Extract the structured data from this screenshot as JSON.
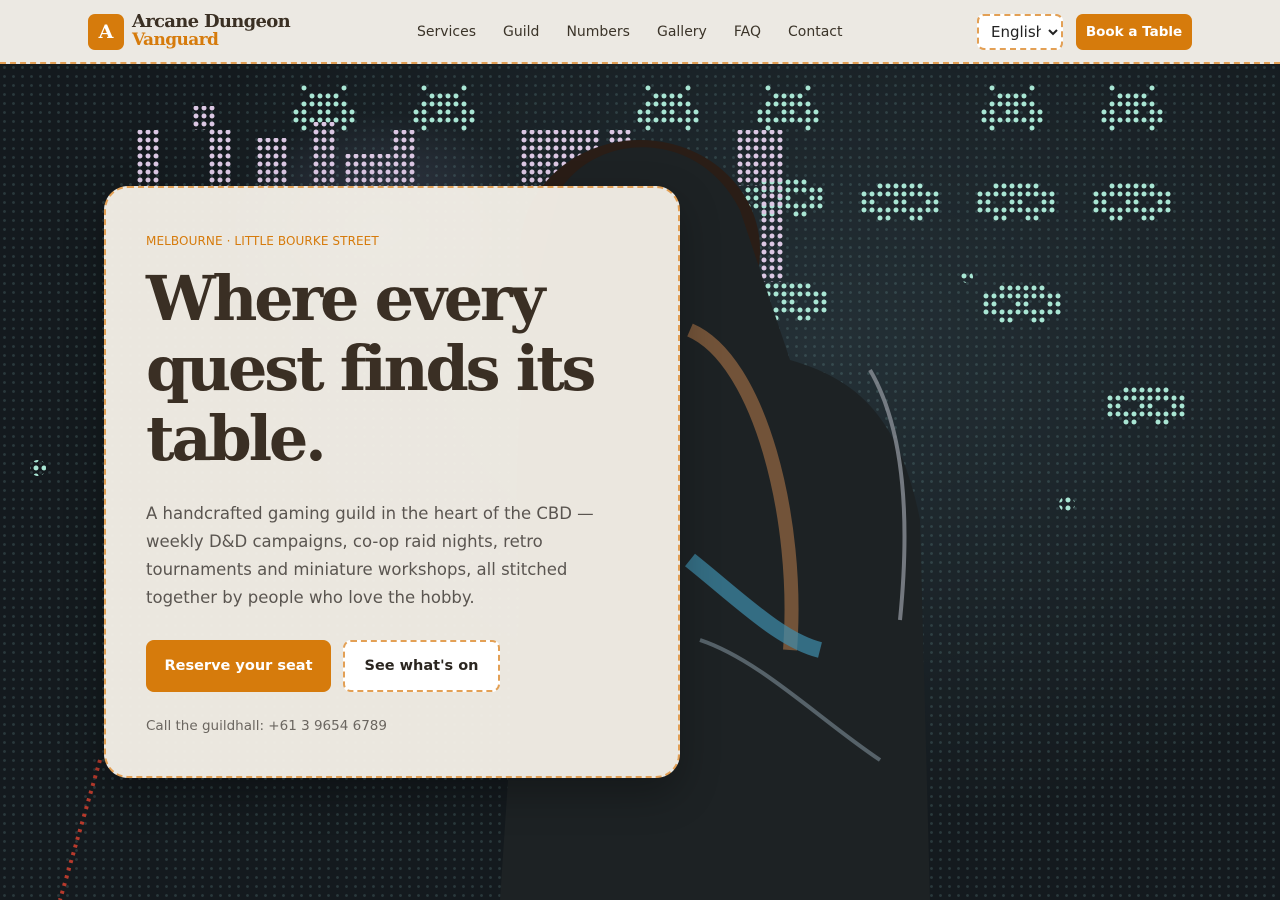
{
  "brand": {
    "mark": "A",
    "name_line1": "Arcane Dungeon",
    "name_line2": "Vanguard",
    "accent_color": "#d67b0c"
  },
  "nav": {
    "items": [
      {
        "label": "Services"
      },
      {
        "label": "Guild"
      },
      {
        "label": "Numbers"
      },
      {
        "label": "Gallery"
      },
      {
        "label": "FAQ"
      },
      {
        "label": "Contact"
      }
    ]
  },
  "language": {
    "selected": "English"
  },
  "header_cta": {
    "label": "Book a Table"
  },
  "hero": {
    "eyebrow": "MELBOURNE · LITTLE BOURKE STREET",
    "headline": "Where every quest finds its table.",
    "lede": "A handcrafted gaming guild in the heart of the CBD — weekly D&D campaigns, co-op raid nights, retro tournaments and miniature workshops, all stitched together by people who love the hobby.",
    "primary_cta": "Reserve your seat",
    "secondary_cta": "See what's on",
    "phone_text": "Call the guildhall: +61 3 9654 6789"
  }
}
